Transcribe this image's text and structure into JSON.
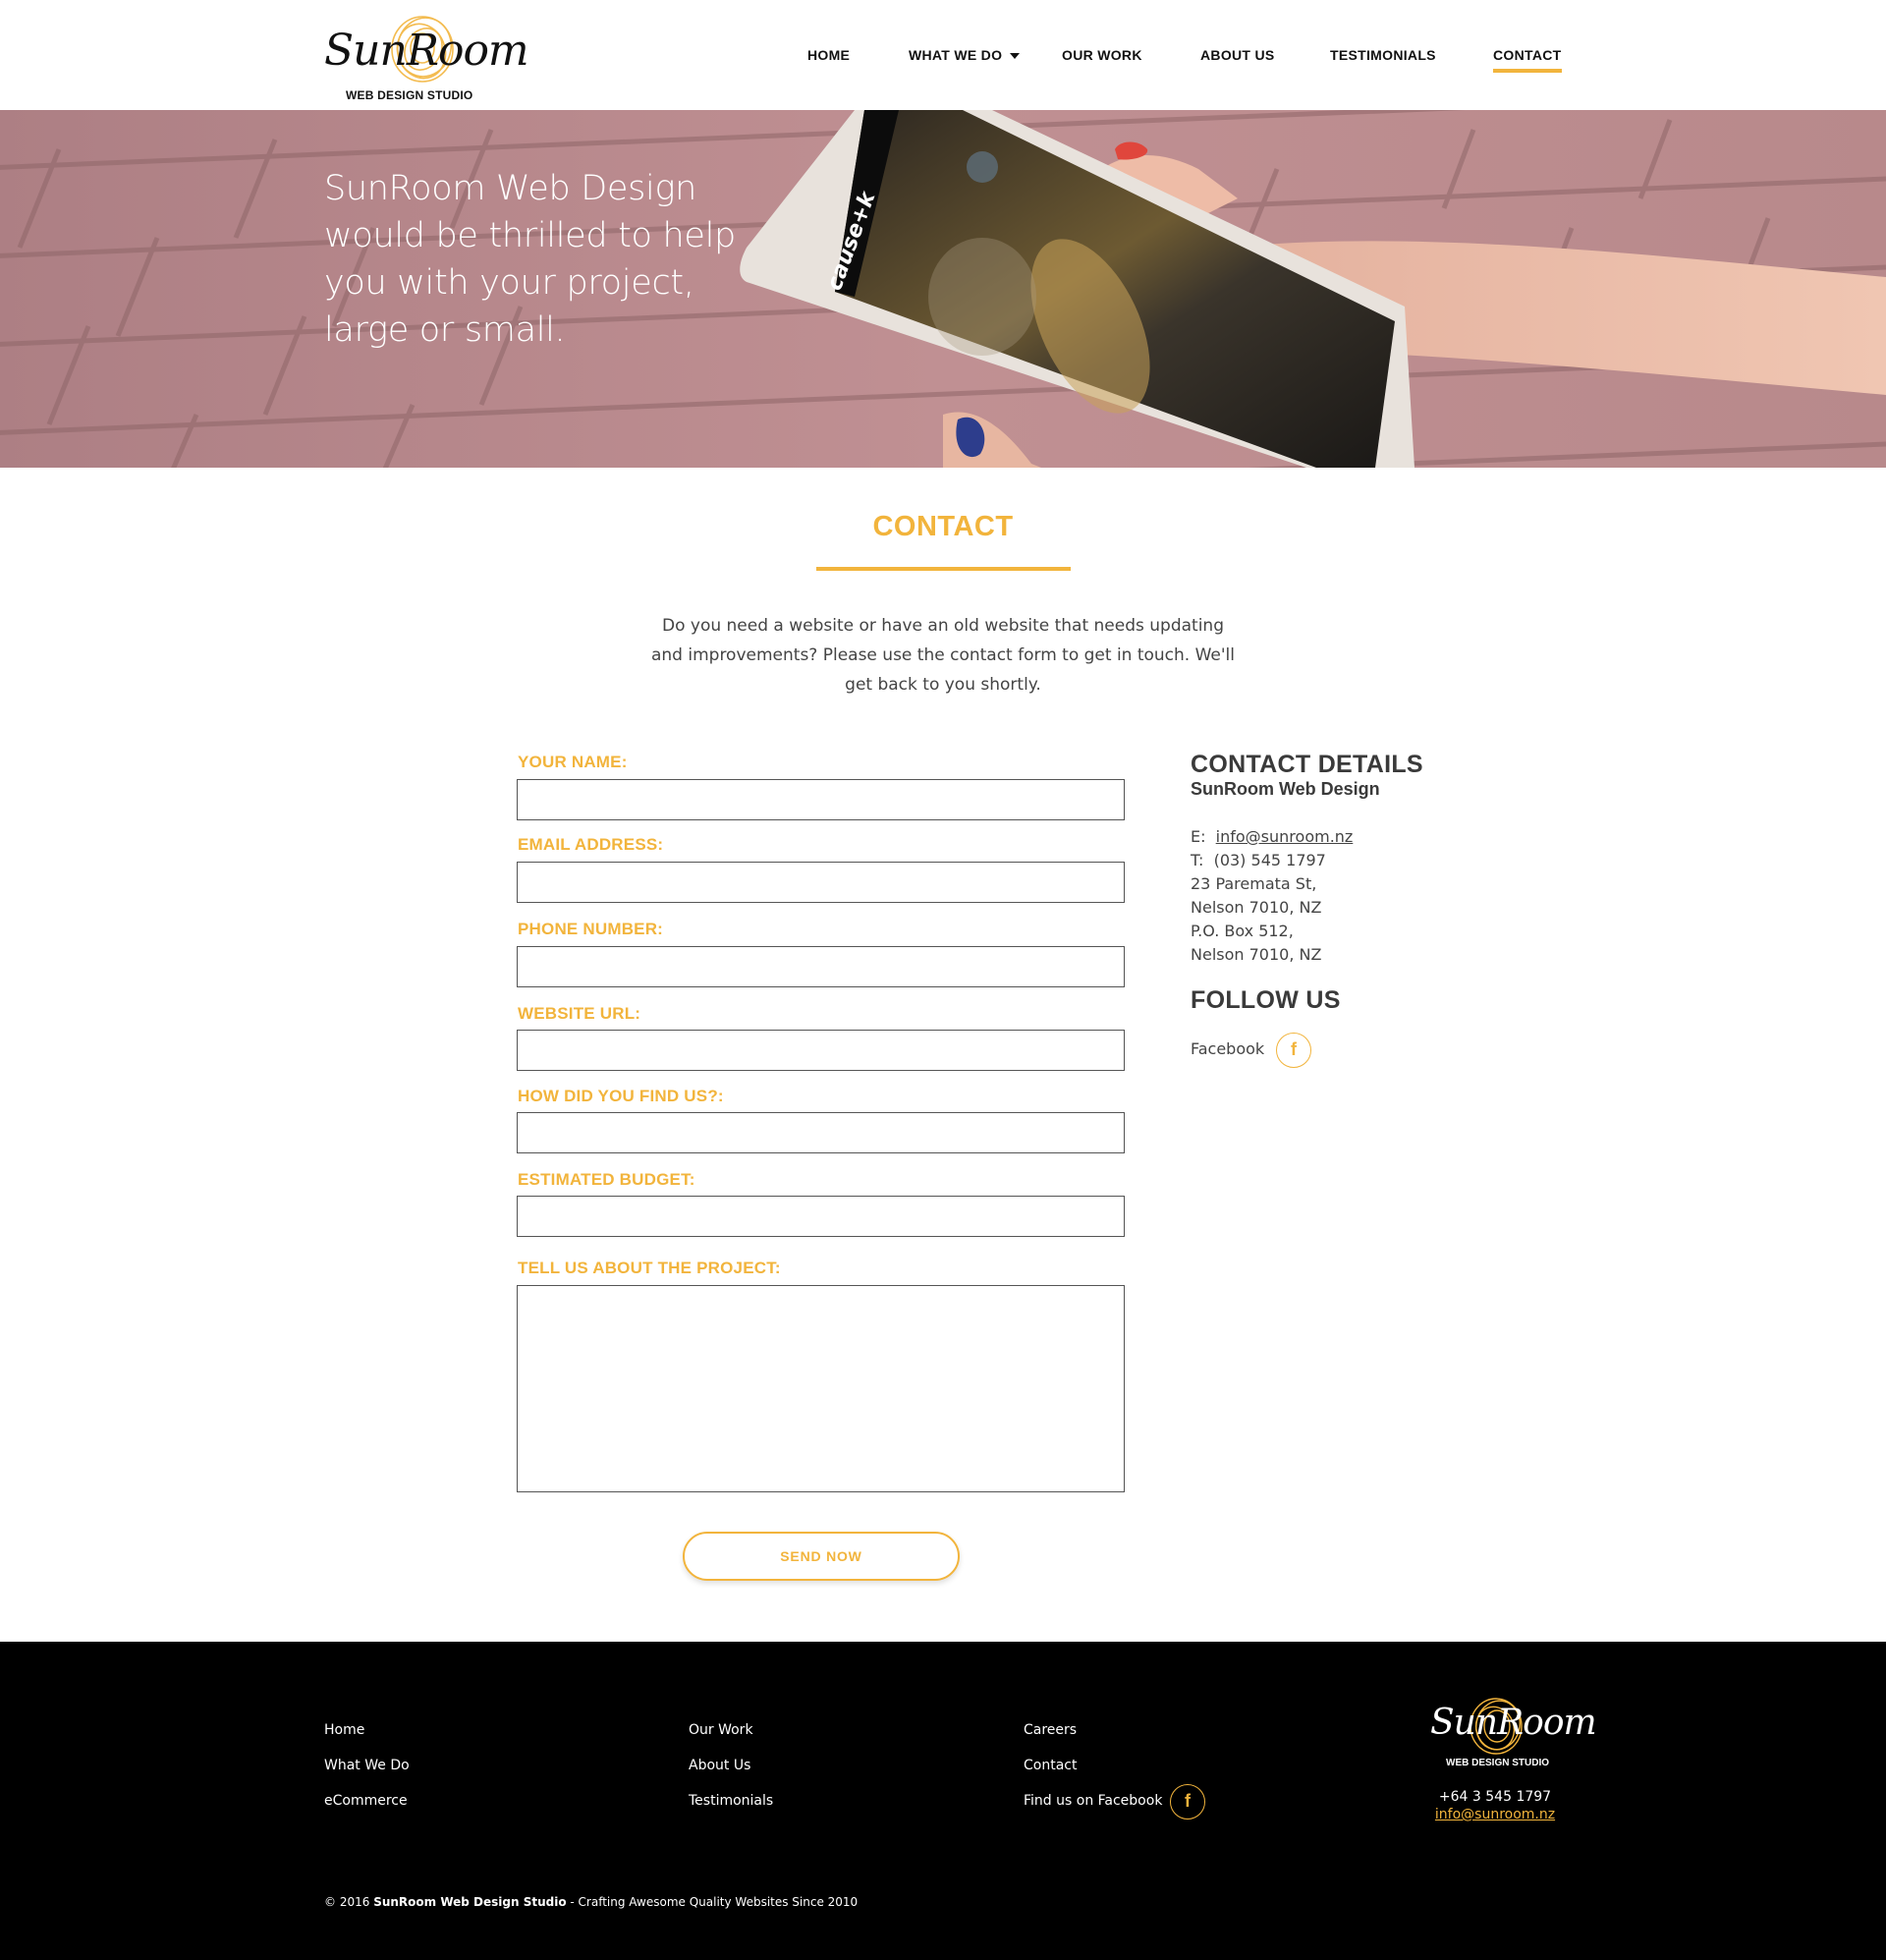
{
  "brand": {
    "name": "SunRoom",
    "tagline": "WEB DESIGN STUDIO",
    "accent_color": "#f2b43c"
  },
  "nav": {
    "items": [
      {
        "label": "HOME"
      },
      {
        "label": "WHAT WE DO"
      },
      {
        "label": "OUR WORK"
      },
      {
        "label": "ABOUT US"
      },
      {
        "label": "TESTIMONIALS"
      },
      {
        "label": "CONTACT"
      }
    ],
    "active": "CONTACT"
  },
  "hero": {
    "text": "SunRoom Web Design would be thrilled to help you with your project, large or small.",
    "tablet_brand": "cause+k"
  },
  "contact": {
    "title": "CONTACT",
    "intro": "Do you need a website or have an old website that needs updating and improvements? Please use the contact form to get in touch. We'll get back to you shortly.",
    "form": {
      "fields": [
        {
          "label": "YOUR NAME:",
          "value": ""
        },
        {
          "label": "EMAIL ADDRESS:",
          "value": ""
        },
        {
          "label": "PHONE NUMBER:",
          "value": ""
        },
        {
          "label": "WEBSITE URL:",
          "value": ""
        },
        {
          "label": "HOW DID YOU FIND US?:",
          "value": ""
        },
        {
          "label": "ESTIMATED BUDGET:",
          "value": ""
        }
      ],
      "message_label": "TELL US ABOUT THE PROJECT:",
      "message_value": "",
      "submit_label": "SEND NOW"
    },
    "details": {
      "heading": "CONTACT DETAILS",
      "company": "SunRoom Web Design",
      "email_prefix": "E:",
      "email": "info@sunroom.nz",
      "phone_prefix": "T:",
      "phone": "(03) 545 1797",
      "address_line1": "23 Paremata St,",
      "address_line2": "Nelson 7010, NZ",
      "po_line1": "P.O. Box 512,",
      "po_line2": "Nelson 7010, NZ"
    },
    "follow": {
      "heading": "FOLLOW US",
      "facebook_label": "Facebook",
      "facebook_icon": "f"
    }
  },
  "footer": {
    "col1": [
      "Home",
      "What We Do",
      "eCommerce"
    ],
    "col2": [
      "Our Work",
      "About Us",
      "Testimonials"
    ],
    "col3": [
      "Careers",
      "Contact",
      "Find us on Facebook"
    ],
    "facebook_icon": "f",
    "phone": "+64 3 545 1797",
    "email": "info@sunroom.nz",
    "copyright_prefix": "© 2016",
    "copyright_company": "SunRoom Web Design Studio",
    "copyright_suffix": "- Crafting Awesome Quality Websites Since 2010"
  }
}
